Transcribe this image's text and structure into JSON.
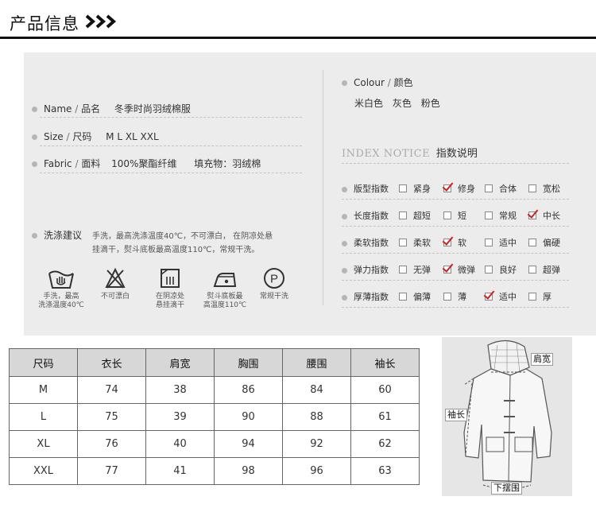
{
  "header": {
    "title": "产品信息"
  },
  "info": {
    "name_label": "Name",
    "name_cn": "品名",
    "name_value": "冬季时尚羽绒棉服",
    "size_label": "Size",
    "size_cn": "尺码",
    "size_value": "M L XL XXL",
    "fabric_label": "Fabric",
    "fabric_cn": "面料",
    "fabric_value": "100%聚酯纤维",
    "filling": "填充物：羽绒棉",
    "wash_title": "洗涤建议",
    "wash_text_1": "手洗，最高洗涤温度40℃，不可漂白， 在阴凉处悬",
    "wash_text_2": "挂滴干，熨斗底板最高温度110℃，常规干洗。"
  },
  "care_icons": [
    {
      "icon": "handwash-40-icon",
      "line1": "手洗，最高",
      "line2": "洗涤温度40℃"
    },
    {
      "icon": "no-bleach-icon",
      "line1": "不可漂白",
      "line2": ""
    },
    {
      "icon": "line-dry-shade-icon",
      "line1": "在阴凉处",
      "line2": "悬挂滴干"
    },
    {
      "icon": "iron-110-icon",
      "line1": "熨斗底板最",
      "line2": "高温度110℃"
    },
    {
      "icon": "dry-clean-p-icon",
      "line1": "常规干洗",
      "line2": ""
    }
  ],
  "colour": {
    "label": "Colour",
    "label_cn": "颜色",
    "options": [
      "米白色",
      "灰色",
      "粉色"
    ]
  },
  "index_notice": {
    "title_en": "INDEX NOTICE",
    "title_cn": "指数说明",
    "rows": [
      {
        "label": "版型指数",
        "options": [
          "紧身",
          "修身",
          "合体",
          "宽松"
        ],
        "selected": 1
      },
      {
        "label": "长度指数",
        "options": [
          "超短",
          "短",
          "常规",
          "中长"
        ],
        "selected": 3
      },
      {
        "label": "柔软指数",
        "options": [
          "柔软",
          "软",
          "适中",
          "偏硬"
        ],
        "selected": 1
      },
      {
        "label": "弹力指数",
        "options": [
          "无弹",
          "微弹",
          "良好",
          "超弹"
        ],
        "selected": 1
      },
      {
        "label": "厚薄指数",
        "options": [
          "偏薄",
          "薄",
          "适中",
          "厚"
        ],
        "selected": 2
      }
    ]
  },
  "size_table": {
    "headers": [
      "尺码",
      "衣长",
      "肩宽",
      "胸围",
      "腰围",
      "袖长"
    ],
    "rows": [
      [
        "M",
        "74",
        "38",
        "86",
        "84",
        "60"
      ],
      [
        "L",
        "75",
        "39",
        "90",
        "88",
        "61"
      ],
      [
        "XL",
        "76",
        "40",
        "94",
        "92",
        "62"
      ],
      [
        "XXL",
        "77",
        "41",
        "98",
        "96",
        "63"
      ]
    ]
  },
  "measure_labels": {
    "shoulder": "肩宽",
    "sleeve": "袖长",
    "hem": "下摆围"
  },
  "colors": {
    "accent_check": "#d21d1d",
    "panel_bg": "#ececec",
    "table_header_bg": "#d7d7d7"
  }
}
